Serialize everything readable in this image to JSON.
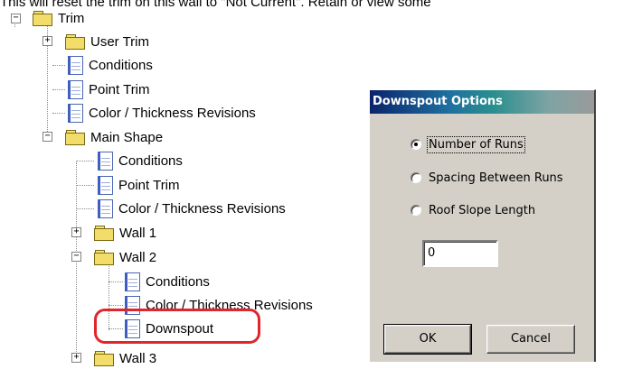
{
  "top_text": "This will reset the trim on this wall to \"Not Current\". Retain or view some",
  "tree": {
    "nodes": [
      {
        "label": "Trim",
        "icon": "folder-icon",
        "expander": "minus"
      },
      {
        "label": "User Trim",
        "icon": "folder-icon",
        "expander": "plus"
      },
      {
        "label": "Conditions",
        "icon": "document-icon"
      },
      {
        "label": "Point Trim",
        "icon": "document-icon"
      },
      {
        "label": "Color / Thickness Revisions",
        "icon": "document-icon"
      },
      {
        "label": "Main Shape",
        "icon": "folder-icon",
        "expander": "minus"
      },
      {
        "label": "Conditions",
        "icon": "document-icon"
      },
      {
        "label": "Point Trim",
        "icon": "document-icon"
      },
      {
        "label": "Color / Thickness Revisions",
        "icon": "document-icon"
      },
      {
        "label": "Wall 1",
        "icon": "folder-icon",
        "expander": "plus"
      },
      {
        "label": "Wall 2",
        "icon": "folder-icon",
        "expander": "minus"
      },
      {
        "label": "Conditions",
        "icon": "document-icon"
      },
      {
        "label": "Color / Thickness Revisions",
        "icon": "document-icon"
      },
      {
        "label": "Downspout",
        "icon": "document-icon",
        "highlighted": true
      },
      {
        "label": "Wall 3",
        "icon": "folder-icon",
        "expander": "plus"
      }
    ],
    "highlight_color": "#e0262d"
  },
  "dialog": {
    "title": "Downspout Options",
    "options": [
      {
        "label": "Number of Runs",
        "checked": true
      },
      {
        "label": "Spacing Between Runs",
        "checked": false
      },
      {
        "label": "Roof Slope Length",
        "checked": false
      }
    ],
    "value": "0",
    "ok_label": "OK",
    "cancel_label": "Cancel"
  }
}
